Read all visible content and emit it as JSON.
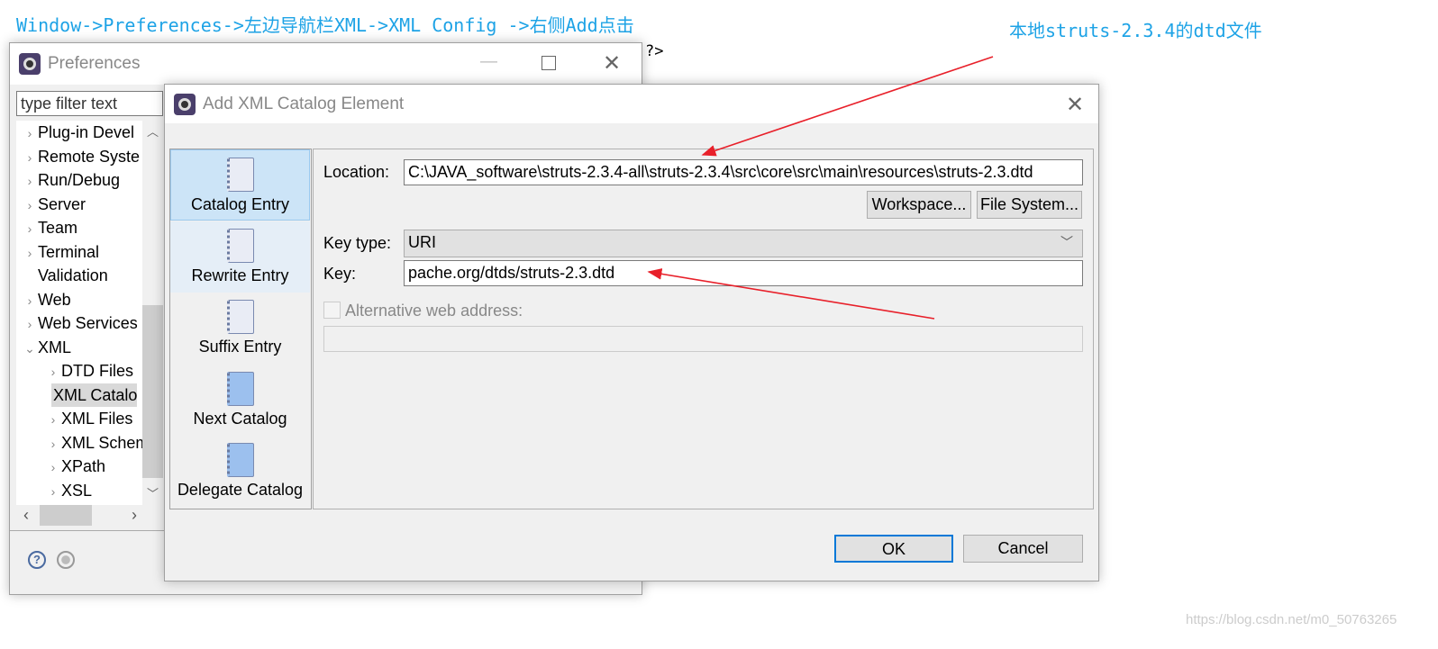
{
  "annotations": {
    "top_instruction": "Window->Preferences->左边导航栏XML->XML Config ->右侧Add点击",
    "local_dtd_note": "本地struts-2.3.4的dtd文件",
    "arrow_color": "#e8202a",
    "text_color": "#1ea3e6"
  },
  "background": {
    "editor_fragment": "?>"
  },
  "preferences": {
    "title": "Preferences",
    "filter_placeholder": "type filter text",
    "tree": [
      {
        "label": "Plug-in Devel",
        "expandable": true
      },
      {
        "label": "Remote Syste",
        "expandable": true
      },
      {
        "label": "Run/Debug",
        "expandable": true
      },
      {
        "label": "Server",
        "expandable": true
      },
      {
        "label": "Team",
        "expandable": true
      },
      {
        "label": "Terminal",
        "expandable": true
      },
      {
        "label": "Validation",
        "expandable": false
      },
      {
        "label": "Web",
        "expandable": true
      },
      {
        "label": "Web Services",
        "expandable": true
      },
      {
        "label": "XML",
        "expanded": true
      },
      {
        "label": "DTD Files",
        "child": true,
        "expandable": true
      },
      {
        "label": "XML Catalo",
        "child": true,
        "selected": true
      },
      {
        "label": "XML Files",
        "child": true,
        "expandable": true
      },
      {
        "label": "XML Schem",
        "child": true,
        "expandable": true
      },
      {
        "label": "XPath",
        "child": true,
        "expandable": true
      },
      {
        "label": "XSL",
        "child": true,
        "expandable": true
      }
    ]
  },
  "dialog": {
    "title": "Add XML Catalog Element",
    "categories": [
      {
        "label": "Catalog Entry",
        "selected": true
      },
      {
        "label": "Rewrite Entry",
        "hover": true
      },
      {
        "label": "Suffix Entry"
      },
      {
        "label": "Next Catalog"
      },
      {
        "label": "Delegate Catalog"
      }
    ],
    "location_label": "Location:",
    "location_value": "C:\\JAVA_software\\struts-2.3.4-all\\struts-2.3.4\\src\\core\\src\\main\\resources\\struts-2.3.dtd",
    "workspace_button": "Workspace...",
    "file_system_button": "File System...",
    "key_type_label": "Key type:",
    "key_type_value": "URI",
    "key_label": "Key:",
    "key_value": "pache.org/dtds/struts-2.3.dtd",
    "alt_web_label": "Alternative web address:",
    "alt_web_checked": false,
    "ok_button": "OK",
    "cancel_button": "Cancel"
  },
  "watermark": "https://blog.csdn.net/m0_50763265"
}
